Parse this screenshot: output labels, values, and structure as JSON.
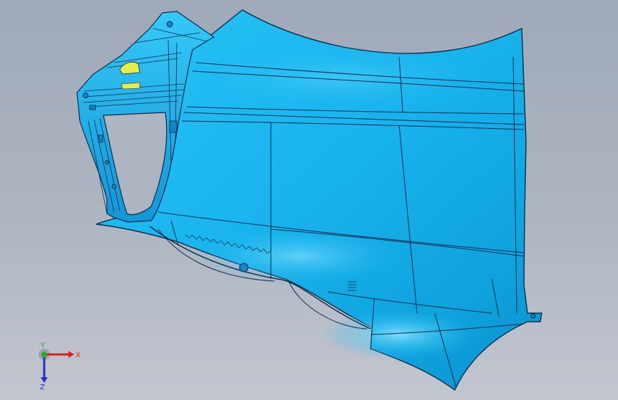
{
  "viewport": {
    "background_top": "#9fa9b8",
    "background_bottom": "#c2c6cf"
  },
  "model": {
    "surface_color": "#1ab6f0",
    "highlight_color": "#7fe0ff",
    "shadow_color": "#0a86c6",
    "edge_color": "#0b2a4a",
    "accent_color": "#e8ec4a"
  },
  "triad": {
    "x_label": "X",
    "y_label": "Y",
    "z_label": "Z",
    "x_color": "#e02020",
    "y_color": "#20b020",
    "z_color": "#2030c0"
  }
}
